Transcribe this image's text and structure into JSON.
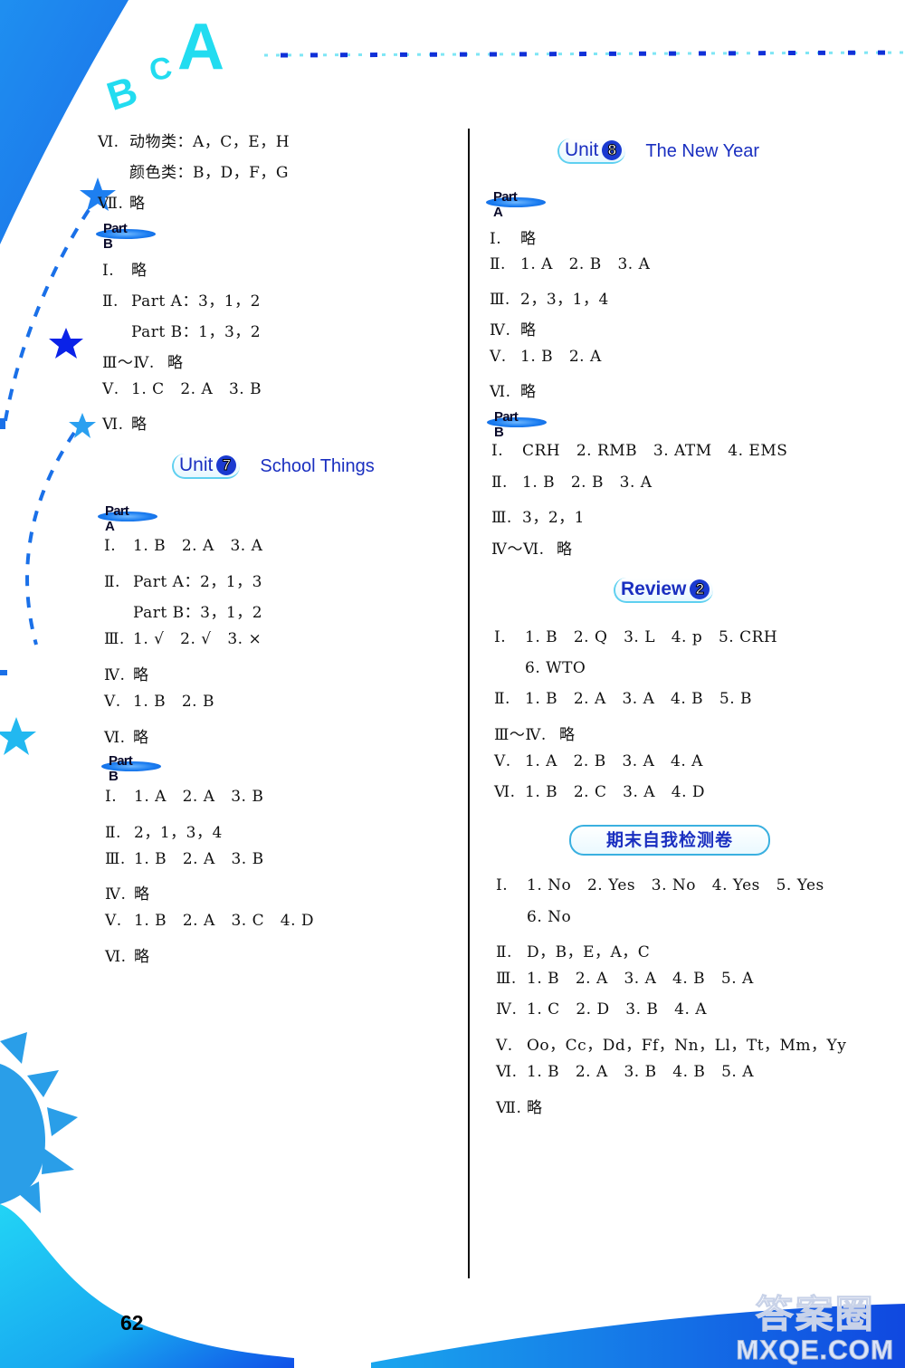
{
  "header": {
    "letters": [
      "B",
      "C",
      "A"
    ]
  },
  "page_number": "62",
  "watermark": {
    "line1": "答案圈",
    "line2": "MXQE.COM"
  },
  "left_column": {
    "lines_top": [
      {
        "n": "Ⅵ.",
        "t": "动物类：A，C，E，H"
      },
      {
        "n": "",
        "t": "颜色类：B，D，F，G"
      },
      {
        "n": "Ⅶ.",
        "t": "略"
      }
    ],
    "part_b_1": {
      "tag": "Part B",
      "lines": [
        {
          "n": "Ⅰ.",
          "t": "略"
        },
        {
          "n": "Ⅱ.",
          "t": "Part A：3，1，2"
        },
        {
          "n": "",
          "t": "Part B：1，3，2"
        },
        {
          "n": "Ⅲ～Ⅳ.",
          "t": "略"
        },
        {
          "n": "Ⅴ.",
          "t": "1. C   2. A   3. B"
        },
        {
          "n": "Ⅵ.",
          "t": "略"
        }
      ]
    },
    "unit7": {
      "unit_word": "Unit",
      "unit_number": "7",
      "title": "School Things",
      "part_a": {
        "tag": "Part A",
        "lines": [
          {
            "n": "Ⅰ.",
            "t": "1. B   2. A   3. A"
          },
          {
            "n": "Ⅱ.",
            "t": "Part A：2，1，3"
          },
          {
            "n": "",
            "t": "Part B：3，1，2"
          },
          {
            "n": "Ⅲ.",
            "t": "1. √   2. √   3. ×"
          },
          {
            "n": "Ⅳ.",
            "t": "略"
          },
          {
            "n": "Ⅴ.",
            "t": "1. B   2. B"
          },
          {
            "n": "Ⅵ.",
            "t": "略"
          }
        ]
      },
      "part_b": {
        "tag": "Part B",
        "lines": [
          {
            "n": "Ⅰ.",
            "t": "1. A   2. A   3. B"
          },
          {
            "n": "Ⅱ.",
            "t": "2，1，3，4"
          },
          {
            "n": "Ⅲ.",
            "t": "1. B   2. A   3. B"
          },
          {
            "n": "Ⅳ.",
            "t": "略"
          },
          {
            "n": "Ⅴ.",
            "t": "1. B   2. A   3. C   4. D"
          },
          {
            "n": "Ⅵ.",
            "t": "略"
          }
        ]
      }
    }
  },
  "right_column": {
    "unit8": {
      "unit_word": "Unit",
      "unit_number": "8",
      "title": "The New Year",
      "part_a": {
        "tag": "Part A",
        "lines": [
          {
            "n": "Ⅰ.",
            "t": "略"
          },
          {
            "n": "Ⅱ.",
            "t": "1. A   2. B   3. A"
          },
          {
            "n": "Ⅲ.",
            "t": "2，3，1，4"
          },
          {
            "n": "Ⅳ.",
            "t": "略"
          },
          {
            "n": "Ⅴ.",
            "t": "1. B   2. A"
          },
          {
            "n": "Ⅵ.",
            "t": "略"
          }
        ]
      },
      "part_b": {
        "tag": "Part B",
        "lines": [
          {
            "n": "Ⅰ.",
            "t": "CRH   2. RMB   3. ATM   4. EMS"
          },
          {
            "n": "Ⅱ.",
            "t": "1. B   2. B   3. A"
          },
          {
            "n": "Ⅲ.",
            "t": "3，2，1"
          },
          {
            "n": "Ⅳ～Ⅵ.",
            "t": "略"
          }
        ]
      }
    },
    "review2": {
      "word": "Review",
      "number": "2",
      "lines": [
        {
          "n": "Ⅰ.",
          "t": "1. B   2. Q   3. L   4. p   5. CRH"
        },
        {
          "n": "",
          "t": "6. WTO"
        },
        {
          "n": "Ⅱ.",
          "t": "1. B   2. A   3. A   4. B   5. B"
        },
        {
          "n": "Ⅲ～Ⅳ.",
          "t": "略"
        },
        {
          "n": "Ⅴ.",
          "t": "1. A   2. B   3. A   4. A"
        },
        {
          "n": "Ⅵ.",
          "t": "1. B   2. C   3. A   4. D"
        }
      ]
    },
    "final_test": {
      "title": "期末自我检测卷",
      "lines": [
        {
          "n": "Ⅰ.",
          "t": "1. No   2. Yes   3. No   4. Yes   5. Yes"
        },
        {
          "n": "",
          "t": "6. No"
        },
        {
          "n": "Ⅱ.",
          "t": "D，B，E，A，C"
        },
        {
          "n": "Ⅲ.",
          "t": "1. B   2. A   3. A   4. B   5. A"
        },
        {
          "n": "Ⅳ.",
          "t": "1. C   2. D   3. B   4. A"
        },
        {
          "n": "Ⅴ.",
          "t": "Oo，Cc，Dd，Ff，Nn，Ll，Tt，Mm，Yy"
        },
        {
          "n": "Ⅵ.",
          "t": "1. B   2. A   3. B   4. B   5. A"
        },
        {
          "n": "Ⅶ.",
          "t": "略"
        }
      ]
    }
  }
}
